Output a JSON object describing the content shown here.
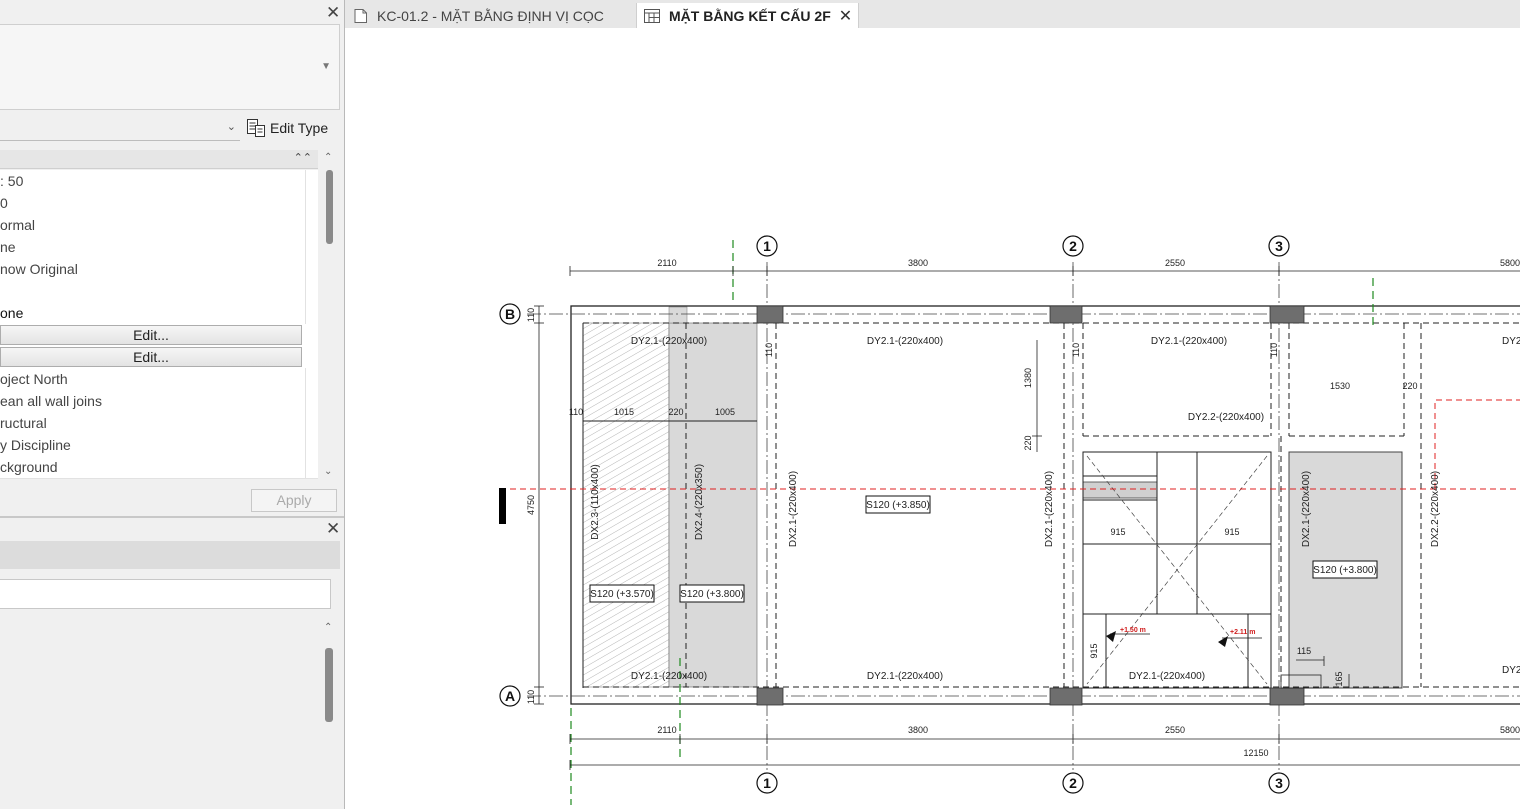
{
  "properties_panel": {
    "edit_type_label": "Edit Type",
    "rows": [
      {
        "text": ": 50",
        "kind": "text"
      },
      {
        "text": "0",
        "kind": "text"
      },
      {
        "text": "ormal",
        "kind": "text"
      },
      {
        "text": "ne",
        "kind": "text"
      },
      {
        "text": "now Original",
        "kind": "text"
      },
      {
        "text": "",
        "kind": "text"
      },
      {
        "text": "one",
        "kind": "bold"
      },
      {
        "text": "Edit...",
        "kind": "button"
      },
      {
        "text": "Edit...",
        "kind": "button"
      },
      {
        "text": "oject North",
        "kind": "text"
      },
      {
        "text": "ean all wall joins",
        "kind": "text"
      },
      {
        "text": "ructural",
        "kind": "text"
      },
      {
        "text": "y Discipline",
        "kind": "text"
      },
      {
        "text": "ckground",
        "kind": "text"
      }
    ],
    "apply_label": "Apply"
  },
  "tabs": [
    {
      "label": "KC-01.2 - MẶT BẰNG ĐỊNH VỊ CỌC",
      "active": false
    },
    {
      "label": "MẶT BẰNG KẾT CẤU 2F",
      "active": true
    }
  ],
  "drawing": {
    "grid_lines": [
      "1",
      "2",
      "3"
    ],
    "grid_rows": [
      "B",
      "A"
    ],
    "top_dims": [
      "2110",
      "3800",
      "2550",
      "5800"
    ],
    "bottom_dims": [
      "2110",
      "3800",
      "2550",
      "5800"
    ],
    "total_dim": "12150",
    "side_dims": {
      "left_110_top": "110",
      "height": "4750",
      "left_110_bottom": "110"
    },
    "inner_dims": [
      "110",
      "1015",
      "220",
      "1005"
    ],
    "beams": {
      "dy21_top_a": "DY2.1-(220x400)",
      "dy21_top_b": "DY2.1-(220x400)",
      "dy21_top_c": "DY2.1-(220x400)",
      "dy21_top_d": "DY2",
      "dy22": "DY2.2-(220x400)",
      "dy21_bot_a": "DY2.1-(220x400)",
      "dy21_bot_b": "DY2.1-(220x400)",
      "dy21_bot_c": "DY2.1-(220x400)",
      "dy21_bot_d": "DY2",
      "dx23": "DX2.3-(110x400)",
      "dx24": "DX2.4-(220x350)",
      "dx21_a": "DX2.1-(220x400)",
      "dx21_b": "DX2.1-(220x400)",
      "dx21_c": "DX2.1-(220x400)",
      "dx22": "DX2.2-(220x400)"
    },
    "slabs": {
      "s1": "S120 (+3.570)",
      "s2": "S120 (+3.800)",
      "s3": "S120 (+3.850)",
      "s4": "S120 (+3.800)"
    },
    "misc_dims": {
      "d1380": "1380",
      "d220a": "220",
      "d110a": "110",
      "d110b": "110",
      "d110c": "110",
      "d1530": "1530",
      "d220b": "220",
      "d915a": "915",
      "d915b": "915",
      "d915c": "915",
      "d115": "115",
      "d165": "165"
    },
    "elevations": {
      "e1": "+1.50 m",
      "e2": "+2.11 m"
    }
  },
  "colors": {
    "panel_bg": "#f0f0f0",
    "slab_fill": "#d9d9d9",
    "column_fill": "#6e6e6e",
    "section_line": "#e02020",
    "grid_marker": "#1f8a1f"
  }
}
